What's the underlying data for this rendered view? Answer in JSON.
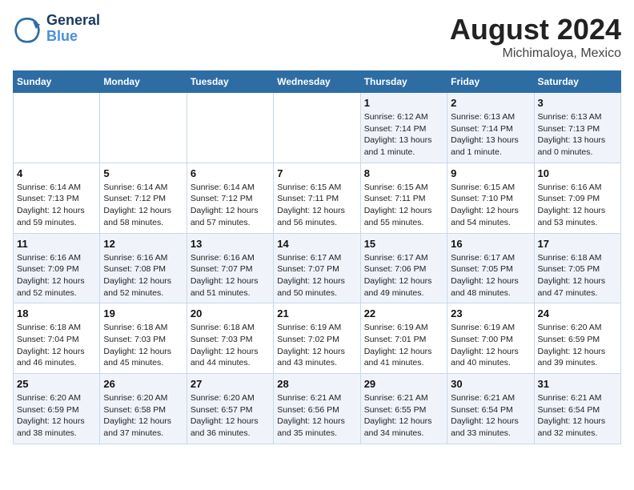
{
  "header": {
    "logo_line1": "General",
    "logo_line2": "Blue",
    "month_year": "August 2024",
    "location": "Michimaloya, Mexico"
  },
  "weekdays": [
    "Sunday",
    "Monday",
    "Tuesday",
    "Wednesday",
    "Thursday",
    "Friday",
    "Saturday"
  ],
  "weeks": [
    [
      {
        "day": null
      },
      {
        "day": null
      },
      {
        "day": null
      },
      {
        "day": null
      },
      {
        "day": 1,
        "sunrise": "6:12 AM",
        "sunset": "7:14 PM",
        "daylight": "13 hours and 1 minute."
      },
      {
        "day": 2,
        "sunrise": "6:13 AM",
        "sunset": "7:14 PM",
        "daylight": "13 hours and 1 minute."
      },
      {
        "day": 3,
        "sunrise": "6:13 AM",
        "sunset": "7:13 PM",
        "daylight": "13 hours and 0 minutes."
      }
    ],
    [
      {
        "day": 4,
        "sunrise": "6:14 AM",
        "sunset": "7:13 PM",
        "daylight": "12 hours and 59 minutes."
      },
      {
        "day": 5,
        "sunrise": "6:14 AM",
        "sunset": "7:12 PM",
        "daylight": "12 hours and 58 minutes."
      },
      {
        "day": 6,
        "sunrise": "6:14 AM",
        "sunset": "7:12 PM",
        "daylight": "12 hours and 57 minutes."
      },
      {
        "day": 7,
        "sunrise": "6:15 AM",
        "sunset": "7:11 PM",
        "daylight": "12 hours and 56 minutes."
      },
      {
        "day": 8,
        "sunrise": "6:15 AM",
        "sunset": "7:11 PM",
        "daylight": "12 hours and 55 minutes."
      },
      {
        "day": 9,
        "sunrise": "6:15 AM",
        "sunset": "7:10 PM",
        "daylight": "12 hours and 54 minutes."
      },
      {
        "day": 10,
        "sunrise": "6:16 AM",
        "sunset": "7:09 PM",
        "daylight": "12 hours and 53 minutes."
      }
    ],
    [
      {
        "day": 11,
        "sunrise": "6:16 AM",
        "sunset": "7:09 PM",
        "daylight": "12 hours and 52 minutes."
      },
      {
        "day": 12,
        "sunrise": "6:16 AM",
        "sunset": "7:08 PM",
        "daylight": "12 hours and 52 minutes."
      },
      {
        "day": 13,
        "sunrise": "6:16 AM",
        "sunset": "7:07 PM",
        "daylight": "12 hours and 51 minutes."
      },
      {
        "day": 14,
        "sunrise": "6:17 AM",
        "sunset": "7:07 PM",
        "daylight": "12 hours and 50 minutes."
      },
      {
        "day": 15,
        "sunrise": "6:17 AM",
        "sunset": "7:06 PM",
        "daylight": "12 hours and 49 minutes."
      },
      {
        "day": 16,
        "sunrise": "6:17 AM",
        "sunset": "7:05 PM",
        "daylight": "12 hours and 48 minutes."
      },
      {
        "day": 17,
        "sunrise": "6:18 AM",
        "sunset": "7:05 PM",
        "daylight": "12 hours and 47 minutes."
      }
    ],
    [
      {
        "day": 18,
        "sunrise": "6:18 AM",
        "sunset": "7:04 PM",
        "daylight": "12 hours and 46 minutes."
      },
      {
        "day": 19,
        "sunrise": "6:18 AM",
        "sunset": "7:03 PM",
        "daylight": "12 hours and 45 minutes."
      },
      {
        "day": 20,
        "sunrise": "6:18 AM",
        "sunset": "7:03 PM",
        "daylight": "12 hours and 44 minutes."
      },
      {
        "day": 21,
        "sunrise": "6:19 AM",
        "sunset": "7:02 PM",
        "daylight": "12 hours and 43 minutes."
      },
      {
        "day": 22,
        "sunrise": "6:19 AM",
        "sunset": "7:01 PM",
        "daylight": "12 hours and 41 minutes."
      },
      {
        "day": 23,
        "sunrise": "6:19 AM",
        "sunset": "7:00 PM",
        "daylight": "12 hours and 40 minutes."
      },
      {
        "day": 24,
        "sunrise": "6:20 AM",
        "sunset": "6:59 PM",
        "daylight": "12 hours and 39 minutes."
      }
    ],
    [
      {
        "day": 25,
        "sunrise": "6:20 AM",
        "sunset": "6:59 PM",
        "daylight": "12 hours and 38 minutes."
      },
      {
        "day": 26,
        "sunrise": "6:20 AM",
        "sunset": "6:58 PM",
        "daylight": "12 hours and 37 minutes."
      },
      {
        "day": 27,
        "sunrise": "6:20 AM",
        "sunset": "6:57 PM",
        "daylight": "12 hours and 36 minutes."
      },
      {
        "day": 28,
        "sunrise": "6:21 AM",
        "sunset": "6:56 PM",
        "daylight": "12 hours and 35 minutes."
      },
      {
        "day": 29,
        "sunrise": "6:21 AM",
        "sunset": "6:55 PM",
        "daylight": "12 hours and 34 minutes."
      },
      {
        "day": 30,
        "sunrise": "6:21 AM",
        "sunset": "6:54 PM",
        "daylight": "12 hours and 33 minutes."
      },
      {
        "day": 31,
        "sunrise": "6:21 AM",
        "sunset": "6:54 PM",
        "daylight": "12 hours and 32 minutes."
      }
    ]
  ],
  "labels": {
    "sunrise_prefix": "Sunrise: ",
    "sunset_prefix": "Sunset: ",
    "daylight_prefix": "Daylight: "
  }
}
